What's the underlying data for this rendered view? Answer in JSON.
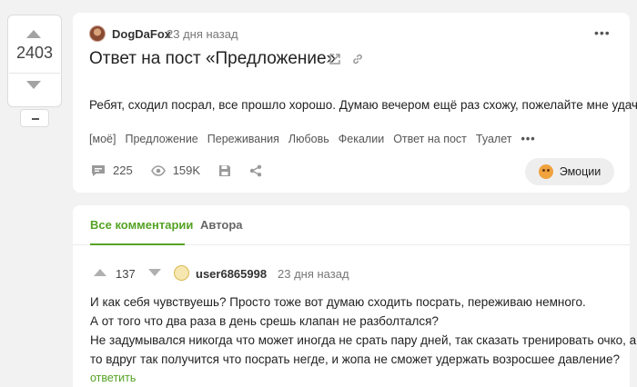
{
  "vote": {
    "rating": "2403"
  },
  "post": {
    "author": "DogDaFox",
    "time": "23 дня назад",
    "title": "Ответ на пост «Предложение»",
    "text": "Ребят, сходил посрал, все прошло хорошо. Думаю вечером ещё раз схожу, пожелайте мне удачи!",
    "tags": [
      "[моё]",
      "Предложение",
      "Переживания",
      "Любовь",
      "Фекалии",
      "Ответ на пост",
      "Туалет"
    ],
    "tags_more": "•••",
    "more_menu": "•••",
    "comments_count": "225",
    "views": "159K",
    "emotions_label": "Эмоции"
  },
  "comments_section": {
    "tabs": [
      "Все комментарии",
      "Автора"
    ],
    "comment": {
      "rating": "137",
      "user": "user6865998",
      "time": "23 дня назад",
      "lines": [
        "И как себя чувствуешь? Просто тоже вот думаю сходить посрать, переживаю немного.",
        "А от того что два раза в день срешь клапан не разболтался?",
        "Не задумывался никогда что может иногда не срать пару дней, так сказать тренировать очко, а",
        "то вдруг так получится что посрать негде, и жопа не сможет удержать возросшее давление?"
      ],
      "reply_label": "ответить"
    }
  },
  "colors": {
    "accent": "#55a324",
    "background": "#f2f2f2"
  },
  "icons": [
    "comment-icon",
    "eye-icon",
    "save-icon",
    "share-icon",
    "external-link-icon",
    "link-icon",
    "emotion-icon"
  ]
}
